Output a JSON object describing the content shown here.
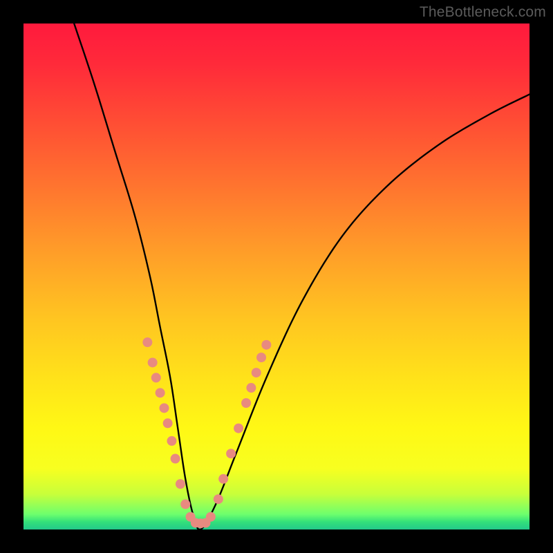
{
  "watermark": "TheBottleneck.com",
  "chart_data": {
    "type": "line",
    "title": "",
    "xlabel": "",
    "ylabel": "",
    "xlim": [
      0,
      100
    ],
    "ylim": [
      0,
      100
    ],
    "grid": false,
    "legend": false,
    "background_gradient": {
      "top": "#ff1a3d",
      "middle": "#ffdf1a",
      "bottom": "#23c98a",
      "meaning": "bottleneck severity (red=high, green=low)"
    },
    "series": [
      {
        "name": "bottleneck-curve",
        "x": [
          10,
          14,
          18,
          22,
          25,
          27,
          29,
          30.5,
          32,
          33.5,
          35,
          38,
          42,
          48,
          55,
          63,
          72,
          82,
          92,
          100
        ],
        "y": [
          100,
          88,
          75,
          62,
          50,
          40,
          30,
          20,
          10,
          3,
          0,
          5,
          15,
          30,
          45,
          58,
          68,
          76,
          82,
          86
        ],
        "color": "#000000"
      }
    ],
    "markers": {
      "name": "highlighted-points",
      "color": "#e88a80",
      "radius_px": 7,
      "points_xy": [
        [
          24.5,
          37
        ],
        [
          25.5,
          33
        ],
        [
          26.2,
          30
        ],
        [
          27.0,
          27
        ],
        [
          27.8,
          24
        ],
        [
          28.5,
          21
        ],
        [
          29.3,
          17.5
        ],
        [
          30.0,
          14
        ],
        [
          31.0,
          9
        ],
        [
          32.0,
          5
        ],
        [
          33.0,
          2.5
        ],
        [
          34.0,
          1.3
        ],
        [
          35.0,
          1.2
        ],
        [
          36.0,
          1.3
        ],
        [
          37.0,
          2.5
        ],
        [
          38.5,
          6
        ],
        [
          39.5,
          10
        ],
        [
          41.0,
          15
        ],
        [
          42.5,
          20
        ],
        [
          44.0,
          25
        ],
        [
          45.0,
          28
        ],
        [
          46.0,
          31
        ],
        [
          47.0,
          34
        ],
        [
          48.0,
          36.5
        ]
      ]
    }
  }
}
